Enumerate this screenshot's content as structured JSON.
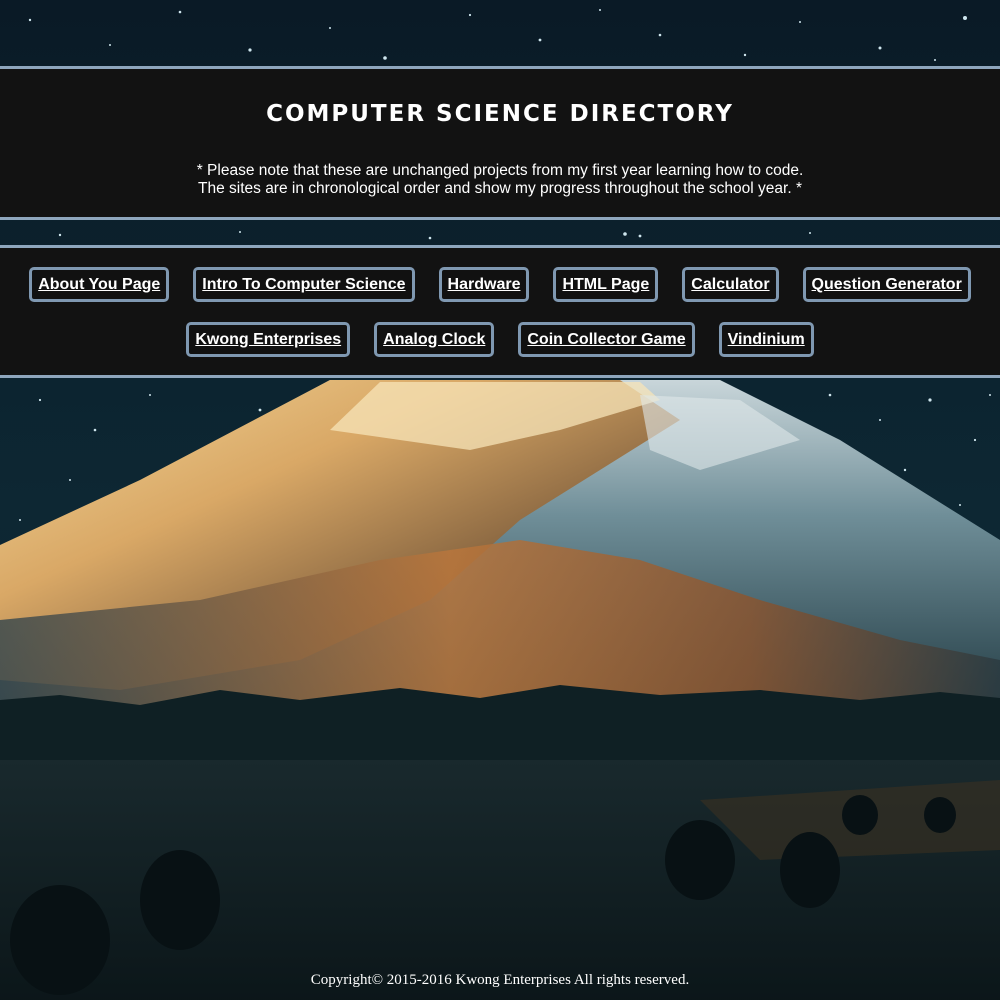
{
  "header": {
    "title": "Computer Science Directory",
    "note_line1": "* Please note that these are unchanged projects from my first year learning how to code.",
    "note_line2": "The sites are in chronological order and show my progress throughout the school year. *"
  },
  "nav": {
    "row1": [
      {
        "label": "About You Page"
      },
      {
        "label": "Intro To Computer Science"
      },
      {
        "label": "Hardware"
      },
      {
        "label": "HTML Page"
      },
      {
        "label": "Calculator"
      },
      {
        "label": "Question Generator"
      }
    ],
    "row2": [
      {
        "label": "Kwong Enterprises"
      },
      {
        "label": "Analog Clock"
      },
      {
        "label": "Coin Collector Game"
      },
      {
        "label": "Vindinium"
      }
    ]
  },
  "footer": {
    "copyright": "Copyright© 2015-2016 Kwong Enterprises All rights reserved."
  },
  "colors": {
    "panel_bg": "#121212",
    "border_accent": "#8ea6bd",
    "text": "#ffffff"
  }
}
